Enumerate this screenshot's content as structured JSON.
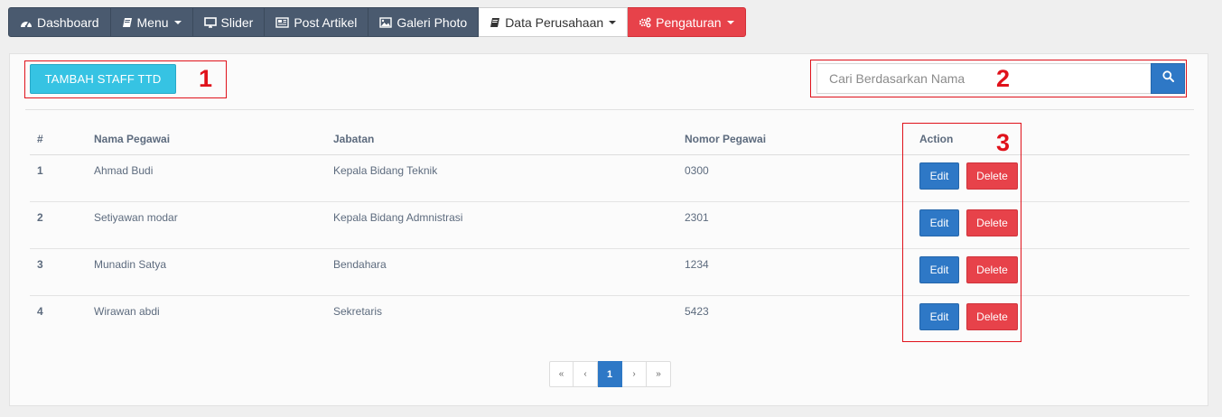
{
  "nav": {
    "items": [
      {
        "label": "Dashboard",
        "icon": "dashboard-icon",
        "dropdown": false
      },
      {
        "label": "Menu",
        "icon": "book-icon",
        "dropdown": true
      },
      {
        "label": "Slider",
        "icon": "monitor-icon",
        "dropdown": false
      },
      {
        "label": "Post Artikel",
        "icon": "newspaper-icon",
        "dropdown": false
      },
      {
        "label": "Galeri Photo",
        "icon": "image-icon",
        "dropdown": false
      },
      {
        "label": "Data Perusahaan",
        "icon": "book-icon",
        "dropdown": true
      },
      {
        "label": "Pengaturan",
        "icon": "gears-icon",
        "dropdown": true
      }
    ]
  },
  "toolbar": {
    "add_label": "TAMBAH STAFF TTD",
    "search_placeholder": "Cari Berdasarkan Nama",
    "search_icon": "search-icon"
  },
  "table": {
    "headers": {
      "num": "#",
      "name": "Nama Pegawai",
      "jabatan": "Jabatan",
      "nomor": "Nomor Pegawai",
      "action": "Action"
    },
    "rows": [
      {
        "num": "1",
        "name": "Ahmad Budi",
        "jabatan": "Kepala Bidang Teknik",
        "nomor": "0300"
      },
      {
        "num": "2",
        "name": "Setiyawan modar",
        "jabatan": "Kepala Bidang Admnistrasi",
        "nomor": "2301"
      },
      {
        "num": "3",
        "name": "Munadin Satya",
        "jabatan": "Bendahara",
        "nomor": "1234"
      },
      {
        "num": "4",
        "name": "Wirawan abdi",
        "jabatan": "Sekretaris",
        "nomor": "5423"
      }
    ],
    "edit_label": "Edit",
    "delete_label": "Delete"
  },
  "pagination": {
    "first": "«",
    "prev": "‹",
    "current": "1",
    "next": "›",
    "last": "»"
  },
  "annotations": [
    "1",
    "2",
    "3"
  ],
  "colors": {
    "nav_dark": "#4a5a6f",
    "nav_red": "#e7424a",
    "add_button": "#36c3e3",
    "primary": "#2e78c6",
    "danger": "#e7424a",
    "annotation": "#e0121b"
  }
}
